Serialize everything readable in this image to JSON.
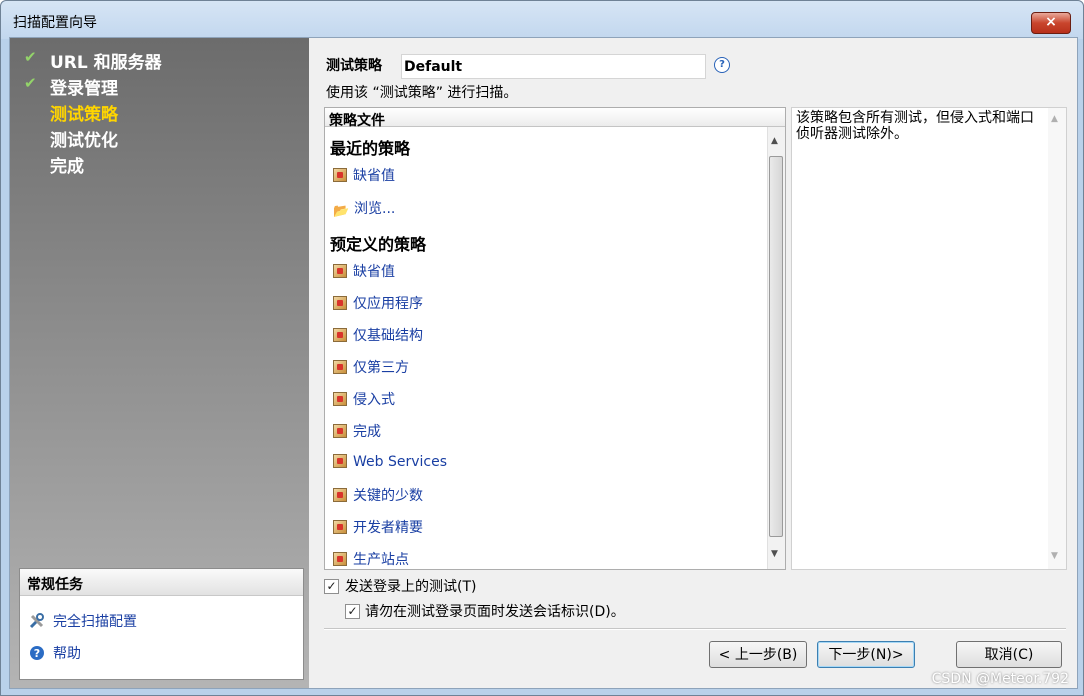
{
  "window": {
    "title": "扫描配置向导",
    "close_icon": "×"
  },
  "steps": [
    {
      "label": "URL 和服务器",
      "done": true
    },
    {
      "label": "登录管理",
      "done": true
    },
    {
      "label": "测试策略",
      "current": true
    },
    {
      "label": "测试优化"
    },
    {
      "label": "完成"
    }
  ],
  "check_glyph": "✔",
  "tasks": {
    "title": "常规任务",
    "items": [
      {
        "label": "完全扫描配置",
        "icon": "tools-icon"
      },
      {
        "label": "帮助",
        "icon": "help-icon"
      }
    ]
  },
  "policy": {
    "label": "测试策略",
    "value": "Default",
    "help": "?",
    "hint": "使用该 “测试策略” 进行扫描。"
  },
  "list": {
    "header": "策略文件",
    "recent_title": "最近的策略",
    "recent": [
      {
        "label": "缺省值",
        "icon": "policy-icon"
      },
      {
        "label": "浏览...",
        "icon": "open-folder-icon"
      }
    ],
    "predefined_title": "预定义的策略",
    "predefined": [
      "缺省值",
      "仅应用程序",
      "仅基础结构",
      "仅第三方",
      "侵入式",
      "完成",
      "Web Services",
      "关键的少数",
      "开发者精要",
      "生产站点"
    ]
  },
  "description": "该策略包含所有测试，但侵入式和端口侦听器测试除外。",
  "checkboxes": {
    "send_login": {
      "label": "发送登录上的测试(T)",
      "checked": true
    },
    "no_session": {
      "label": "请勿在测试登录页面时发送会话标识(D)。",
      "checked": true
    }
  },
  "buttons": {
    "back": "< 上一步(B)",
    "next": "下一步(N)>",
    "cancel": "取消(C)"
  },
  "watermark": "CSDN @Meteor.792"
}
